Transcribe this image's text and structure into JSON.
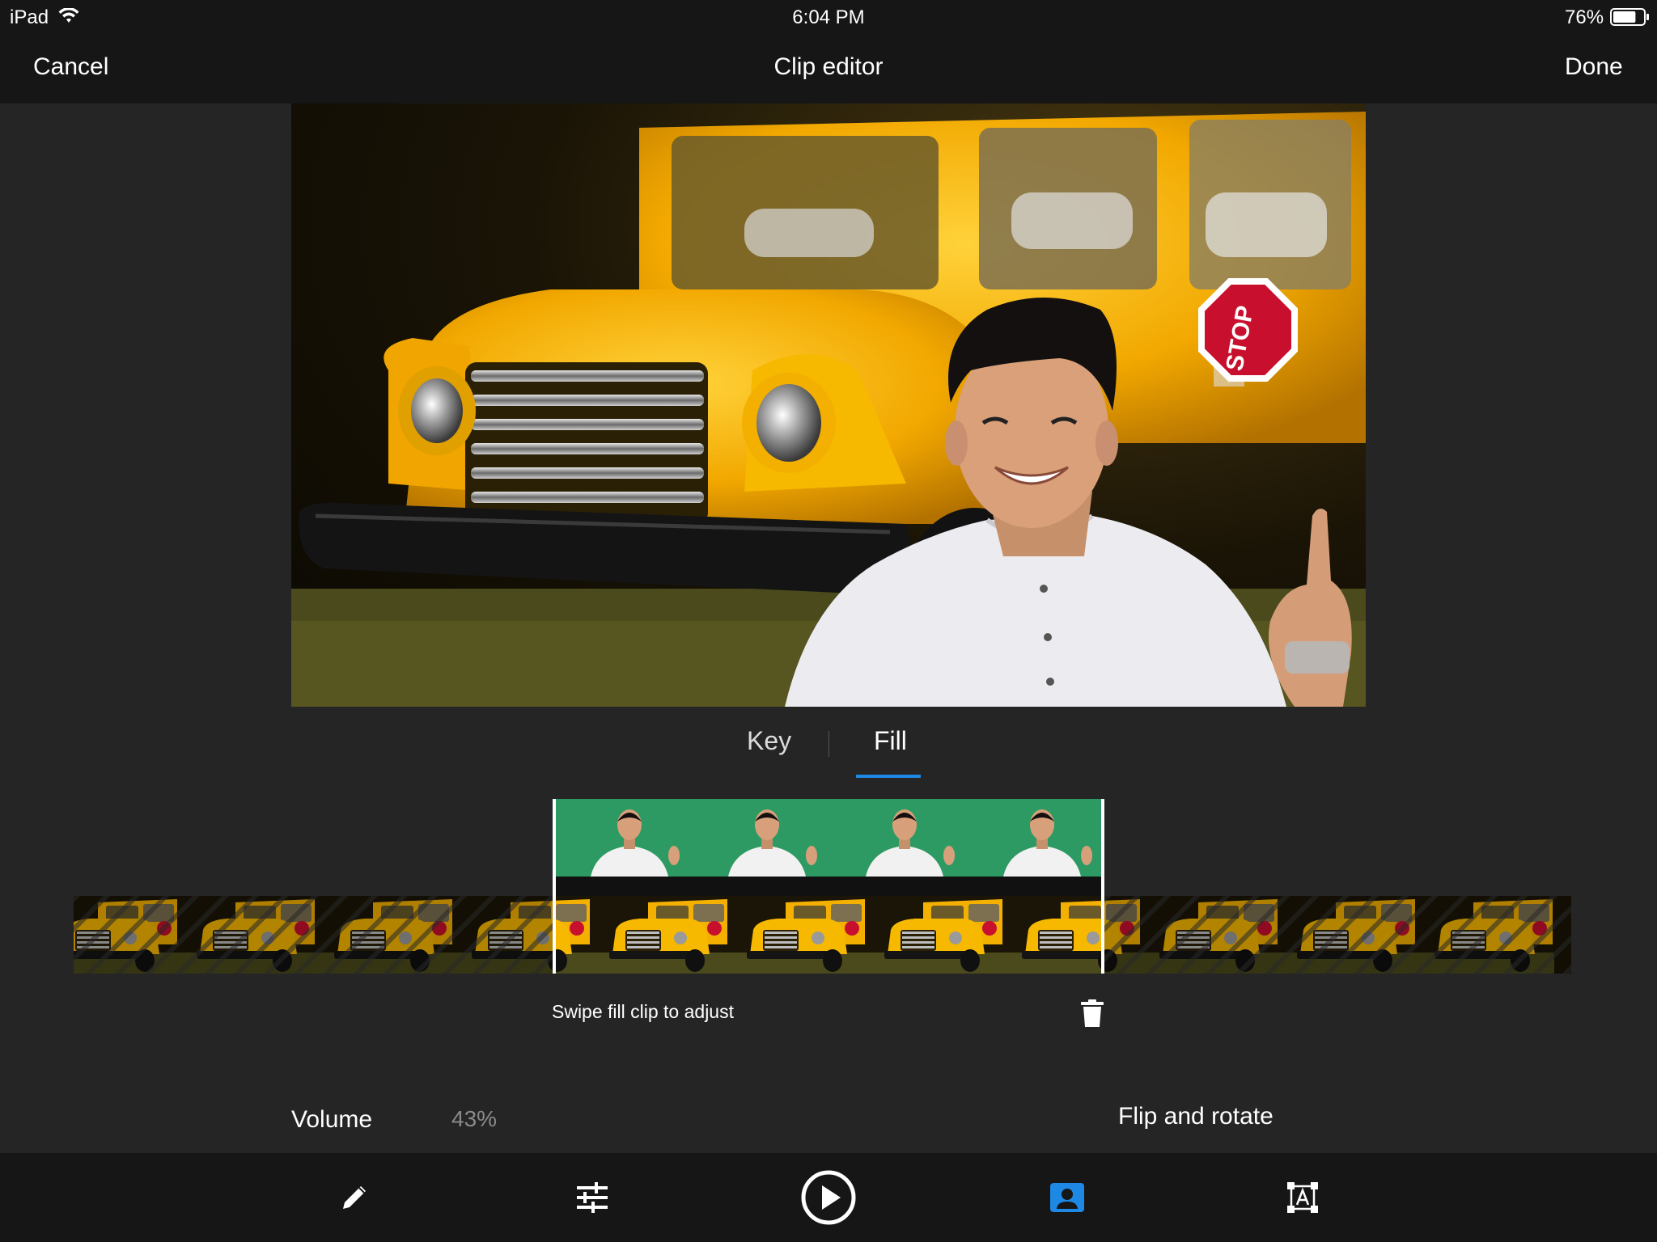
{
  "status": {
    "device": "iPad",
    "time": "6:04 PM",
    "battery": "76%",
    "battery_level": 0.76
  },
  "nav": {
    "cancel": "Cancel",
    "title": "Clip editor",
    "done": "Done"
  },
  "preview": {
    "sign_text": "STOP"
  },
  "tabs": [
    {
      "label": "Key",
      "active": false
    },
    {
      "label": "Fill",
      "active": true
    }
  ],
  "timeline": {
    "hint": "Swipe fill clip to adjust"
  },
  "controls": {
    "volume_label": "Volume",
    "volume_value": "43%",
    "flip_rotate": "Flip and rotate"
  },
  "toolbar": {
    "items": [
      {
        "icon": "pencil-icon",
        "active": false
      },
      {
        "icon": "sliders-icon",
        "active": false
      },
      {
        "icon": "play-icon",
        "active": false
      },
      {
        "icon": "person-card-icon",
        "active": true
      },
      {
        "icon": "text-frame-icon",
        "active": false
      }
    ]
  },
  "colors": {
    "accent": "#1e88e5",
    "bar_background": "#161616",
    "panel_background": "#252525",
    "green_screen": "#2e9a63",
    "bus_yellow": "#f5b400"
  }
}
